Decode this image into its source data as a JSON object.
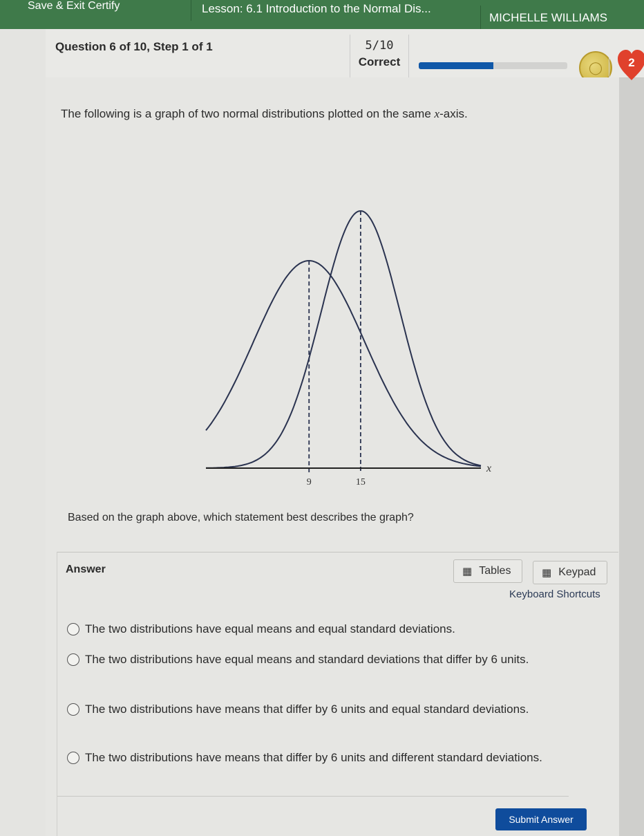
{
  "topbar": {
    "save_exit": "Save & Exit Certify",
    "lesson": "Lesson: 6.1 Introduction to the Normal Dis...",
    "user_name": "MICHELLE WILLIAMS",
    "color": "#3f7a4a"
  },
  "header": {
    "question_title": "Question 6 of 10, Step 1 of 1",
    "score": "5/10",
    "score_label": "Correct",
    "progress_fraction": 0.5,
    "coin_icon": "coin-icon",
    "hearts": "2",
    "accent_color": "#1058a8"
  },
  "question": {
    "prompt_text": "The following is a graph of two normal distributions plotted on the same",
    "prompt_var": "x",
    "prompt_tail": "-axis.",
    "followup": "Based on the graph above, which statement best describes the graph?"
  },
  "chart_data": {
    "type": "line",
    "title": "",
    "xlabel": "x",
    "ylabel": "",
    "x_ticks": [
      "9",
      "15"
    ],
    "series": [
      {
        "name": "distribution-A",
        "mean": 9,
        "relative_spread": "wider",
        "relative_peak": "lower"
      },
      {
        "name": "distribution-B",
        "mean": 15,
        "relative_spread": "narrower",
        "relative_peak": "higher"
      }
    ],
    "mean_markers": "dashed vertical lines at each mean",
    "grid": false
  },
  "answer": {
    "label": "Answer",
    "tables_label": "Tables",
    "keypad_label": "Keypad",
    "keyboard_shortcuts": "Keyboard Shortcuts",
    "options": [
      "The two distributions have equal means and equal standard deviations.",
      "The two distributions have equal means and standard deviations that differ by 6 units.",
      "The two distributions have means that differ by 6 units and equal standard deviations.",
      "The two distributions have means that differ by 6 units and different standard deviations."
    ],
    "submit_label": "Submit Answer"
  }
}
